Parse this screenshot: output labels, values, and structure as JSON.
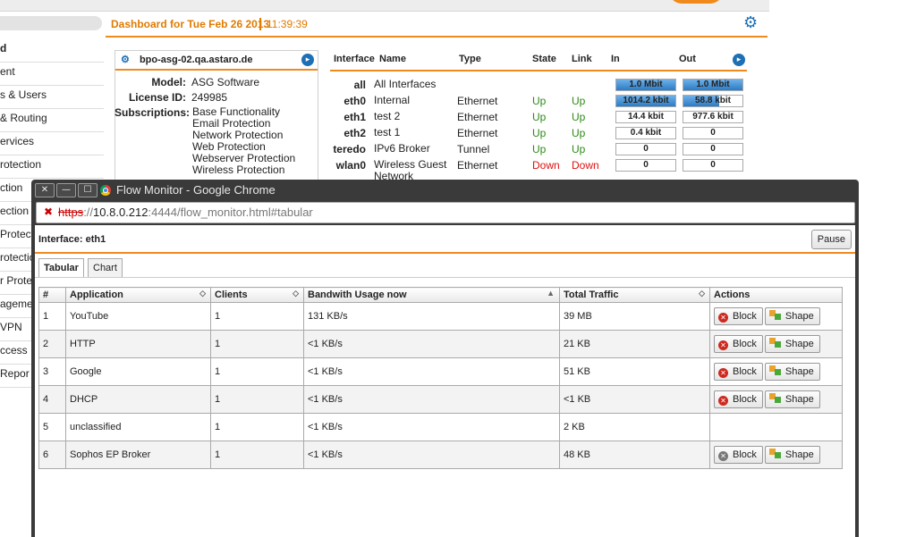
{
  "dashboard": {
    "title": "Dashboard for Tue Feb 26 2013",
    "time": "11:39:39",
    "nav": [
      "d",
      "ent",
      "s & Users",
      "& Routing",
      "ervices",
      "rotection",
      "ction",
      "ection",
      "Protectio",
      "rotectio",
      "r Protec",
      "agement",
      "VPN",
      "ccess",
      "Repor"
    ],
    "device": {
      "hostname": "bpo-asg-02.qa.astaro.de",
      "model_label": "Model:",
      "model": "ASG Software",
      "license_label": "License ID:",
      "license": "249985",
      "subs_label": "Subscriptions:",
      "subscriptions": [
        "Base Functionality",
        "Email Protection",
        "Network Protection",
        "Web Protection",
        "Webserver Protection",
        "Wireless Protection"
      ]
    },
    "interfaces": {
      "headers": {
        "interface": "Interface",
        "name": "Name",
        "type": "Type",
        "state": "State",
        "link": "Link",
        "in": "In",
        "out": "Out"
      },
      "rows": [
        {
          "iface": "all",
          "name": "All Interfaces",
          "type": "",
          "state": "",
          "link": "",
          "in": "1.0 Mbit",
          "out": "1.0 Mbit",
          "in_fill": 1.0,
          "out_fill": 1.0
        },
        {
          "iface": "eth0",
          "name": "Internal",
          "type": "Ethernet",
          "state": "Up",
          "link": "Up",
          "in": "1014.2 kbit",
          "out": "58.8 kbit",
          "in_fill": 1.0,
          "out_fill": 0.6
        },
        {
          "iface": "eth1",
          "name": "test 2",
          "type": "Ethernet",
          "state": "Up",
          "link": "Up",
          "in": "14.4 kbit",
          "out": "977.6 kbit",
          "in_fill": 0,
          "out_fill": 0
        },
        {
          "iface": "eth2",
          "name": "test 1",
          "type": "Ethernet",
          "state": "Up",
          "link": "Up",
          "in": "0.4 kbit",
          "out": "0",
          "in_fill": 0,
          "out_fill": 0
        },
        {
          "iface": "teredo",
          "name": "IPv6 Broker",
          "type": "Tunnel",
          "state": "Up",
          "link": "Up",
          "in": "0",
          "out": "0",
          "in_fill": 0,
          "out_fill": 0
        },
        {
          "iface": "wlan0",
          "name": "Wireless Guest Network",
          "type": "Ethernet",
          "state": "Down",
          "link": "Down",
          "in": "0",
          "out": "0",
          "in_fill": 0,
          "out_fill": 0
        }
      ]
    }
  },
  "window": {
    "title": "Flow Monitor - Google Chrome",
    "url_scheme": "https",
    "url_sep": "://",
    "url_host": "10.8.0.212",
    "url_rest": ":4444/flow_monitor.html#tabular"
  },
  "flow": {
    "interface_label": "Interface: eth1",
    "pause_label": "Pause",
    "tabs": [
      "Tabular",
      "Chart"
    ],
    "columns": [
      "#",
      "Application",
      "Clients",
      "Bandwith Usage now",
      "Total Traffic",
      "Actions"
    ],
    "block_label": "Block",
    "shape_label": "Shape",
    "rows": [
      {
        "num": "1",
        "app": "YouTube",
        "clients": "1",
        "bw": "131 KB/s",
        "total": "39 MB",
        "actions": true,
        "block_enabled": true
      },
      {
        "num": "2",
        "app": "HTTP",
        "clients": "1",
        "bw": "<1 KB/s",
        "total": "21 KB",
        "actions": true,
        "block_enabled": true
      },
      {
        "num": "3",
        "app": "Google",
        "clients": "1",
        "bw": "<1 KB/s",
        "total": "51 KB",
        "actions": true,
        "block_enabled": true
      },
      {
        "num": "4",
        "app": "DHCP",
        "clients": "1",
        "bw": "<1 KB/s",
        "total": "<1 KB",
        "actions": true,
        "block_enabled": true
      },
      {
        "num": "5",
        "app": "unclassified",
        "clients": "1",
        "bw": "<1 KB/s",
        "total": "2 KB",
        "actions": false,
        "block_enabled": false
      },
      {
        "num": "6",
        "app": "Sophos EP Broker",
        "clients": "1",
        "bw": "<1 KB/s",
        "total": "48 KB",
        "actions": true,
        "block_enabled": false
      }
    ]
  },
  "colors": {
    "accent": "#f08a1c",
    "link_blue": "#1e6fb4",
    "up": "#2c8a17",
    "down": "#dd1111"
  }
}
